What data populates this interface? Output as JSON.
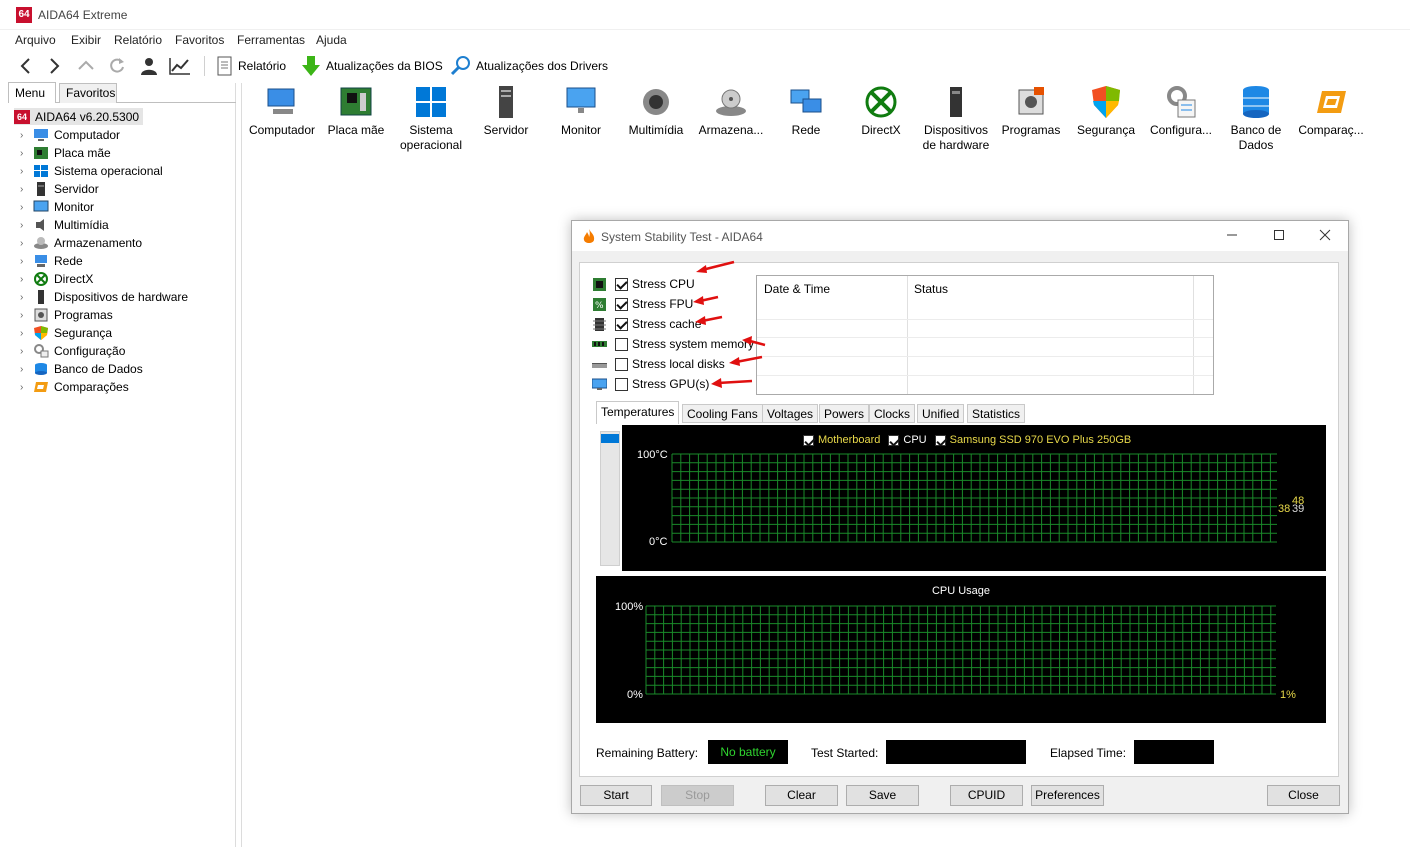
{
  "app": {
    "logo": "64",
    "title": "AIDA64 Extreme"
  },
  "menu": [
    "Arquivo",
    "Exibir",
    "Relatório",
    "Favoritos",
    "Ferramentas",
    "Ajuda"
  ],
  "toolbar": {
    "report": "Relatório",
    "bios_updates": "Atualizações da BIOS",
    "driver_updates": "Atualizações dos Drivers"
  },
  "panel_tabs": {
    "menu": "Menu",
    "favorites": "Favoritos"
  },
  "tree": {
    "root": "AIDA64 v6.20.5300",
    "items": [
      "Computador",
      "Placa mãe",
      "Sistema operacional",
      "Servidor",
      "Monitor",
      "Multimídia",
      "Armazenamento",
      "Rede",
      "DirectX",
      "Dispositivos de hardware",
      "Programas",
      "Segurança",
      "Configuração",
      "Banco de Dados",
      "Comparações"
    ]
  },
  "categories": [
    {
      "line1": "Computador",
      "line2": ""
    },
    {
      "line1": "Placa mãe",
      "line2": ""
    },
    {
      "line1": "Sistema",
      "line2": "operacional"
    },
    {
      "line1": "Servidor",
      "line2": ""
    },
    {
      "line1": "Monitor",
      "line2": ""
    },
    {
      "line1": "Multimídia",
      "line2": ""
    },
    {
      "line1": "Armazena...",
      "line2": ""
    },
    {
      "line1": "Rede",
      "line2": ""
    },
    {
      "line1": "DirectX",
      "line2": ""
    },
    {
      "line1": "Dispositivos",
      "line2": "de hardware"
    },
    {
      "line1": "Programas",
      "line2": ""
    },
    {
      "line1": "Segurança",
      "line2": ""
    },
    {
      "line1": "Configura...",
      "line2": ""
    },
    {
      "line1": "Banco de",
      "line2": "Dados"
    },
    {
      "line1": "Comparaç...",
      "line2": ""
    }
  ],
  "dialog": {
    "title": "System Stability Test - AIDA64",
    "stress": [
      {
        "label": "Stress CPU",
        "checked": true
      },
      {
        "label": "Stress FPU",
        "checked": true
      },
      {
        "label": "Stress cache",
        "checked": true
      },
      {
        "label": "Stress system memory",
        "checked": false
      },
      {
        "label": "Stress local disks",
        "checked": false
      },
      {
        "label": "Stress GPU(s)",
        "checked": false
      }
    ],
    "log_headers": {
      "date": "Date & Time",
      "status": "Status"
    },
    "tabs": [
      "Temperatures",
      "Cooling Fans",
      "Voltages",
      "Powers",
      "Clocks",
      "Unified",
      "Statistics"
    ],
    "temp_chart": {
      "legend": [
        "Motherboard",
        "CPU",
        "Samsung SSD 970 EVO Plus 250GB"
      ],
      "y_top": "100°C",
      "y_bottom": "0°C",
      "readings": [
        "48",
        "38",
        "39"
      ]
    },
    "cpu_chart": {
      "title": "CPU Usage",
      "y_top": "100%",
      "y_bottom": "0%",
      "reading": "1%"
    },
    "status": {
      "battery_label": "Remaining Battery:",
      "battery_value": "No battery",
      "started_label": "Test Started:",
      "elapsed_label": "Elapsed Time:"
    },
    "buttons": {
      "start": "Start",
      "stop": "Stop",
      "clear": "Clear",
      "save": "Save",
      "cpuid": "CPUID",
      "preferences": "Preferences",
      "close": "Close"
    }
  },
  "colors": {
    "grid": "#1a8a2a",
    "accent": "#0078d7",
    "reading_text": "#e8d94a",
    "arrow": "#e01010",
    "battery_text": "#2fd42f"
  }
}
